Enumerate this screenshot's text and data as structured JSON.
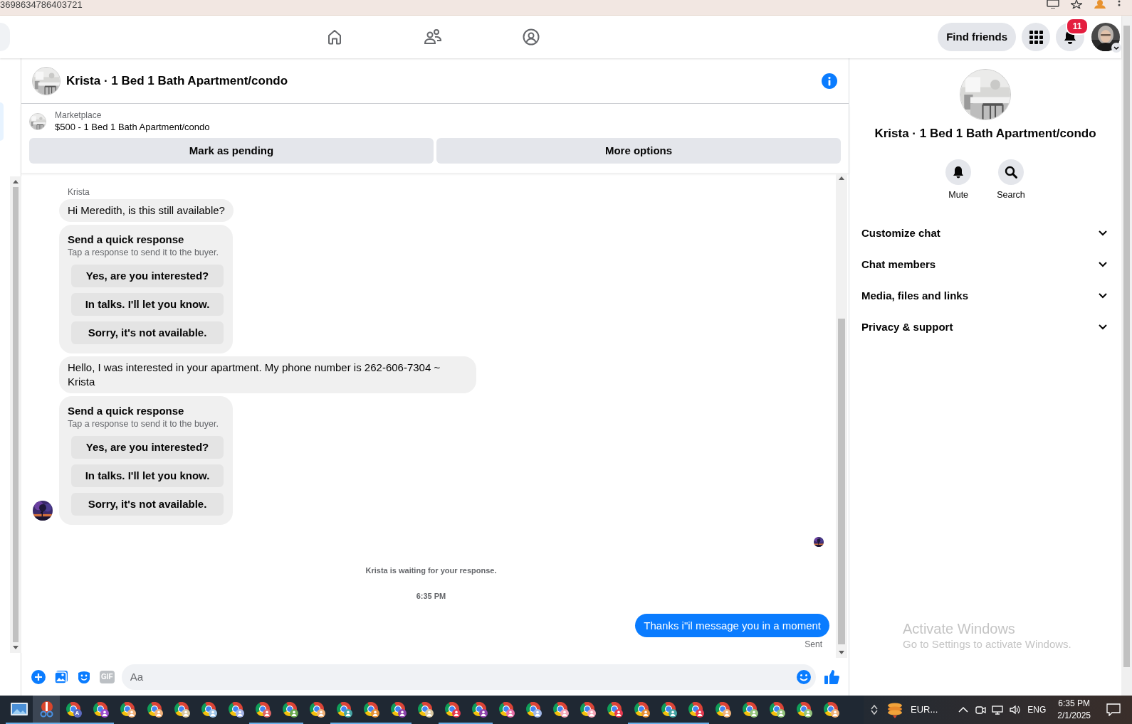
{
  "browser": {
    "address": "3698634786403721"
  },
  "nav": {
    "find_friends": "Find friends",
    "notification_count": "11"
  },
  "chat": {
    "title": "Krista · 1 Bed 1 Bath Apartment/condo",
    "listing": {
      "source": "Marketplace",
      "title": "$500 - 1 Bed 1 Bath Apartment/condo"
    },
    "actions": [
      "Mark as pending",
      "More options"
    ],
    "messages": [
      {
        "kind": "sender",
        "text": "Krista"
      },
      {
        "kind": "incoming",
        "text": "Hi Meredith, is this still available?"
      },
      {
        "kind": "quick_response",
        "title": "Send a quick response",
        "subtitle": "Tap a response to send it to the buyer.",
        "options": [
          "Yes, are you interested?",
          "In talks. I'll let you know.",
          "Sorry, it's not available."
        ],
        "avatar": false
      },
      {
        "kind": "incoming",
        "text": "Hello, I was interested in your apartment. My phone number is 262-606-7304 ~ Krista"
      },
      {
        "kind": "quick_response",
        "title": "Send a quick response",
        "subtitle": "Tap a response to send it to the buyer.",
        "options": [
          "Yes, are you interested?",
          "In talks. I'll let you know.",
          "Sorry, it's not available."
        ],
        "avatar": true
      },
      {
        "kind": "seen"
      },
      {
        "kind": "notice",
        "text": "Krista is waiting for your response."
      },
      {
        "kind": "timestamp",
        "text": "6:35 PM"
      },
      {
        "kind": "outgoing",
        "text": "Thanks i\"il message you in a moment",
        "status": "Sent"
      }
    ],
    "composer": {
      "gif_label": "GIF",
      "placeholder": "Aa"
    }
  },
  "details": {
    "title": "Krista · 1 Bed 1 Bath Apartment/condo",
    "actions": [
      {
        "kind": "mute",
        "label": "Mute"
      },
      {
        "kind": "search",
        "label": "Search"
      }
    ],
    "sections": [
      {
        "label": "Customize chat",
        "expanded": false
      },
      {
        "label": "Chat members",
        "expanded": false
      },
      {
        "label": "Media, files and links",
        "expanded": false
      },
      {
        "label": "Privacy & support",
        "expanded": false
      }
    ]
  },
  "activation_notice": {
    "title": "Activate Windows",
    "subtitle": "Go to Settings to activate Windows."
  },
  "taskbar": {
    "apps": [
      {
        "kind": "photos",
        "open": true,
        "selected": false
      },
      {
        "kind": "snip",
        "open": true,
        "selected": true
      },
      {
        "kind": "chrome",
        "open": true,
        "selected": false,
        "color": "#5c6bc0",
        "badge_text": "A"
      },
      {
        "kind": "chrome",
        "open": true,
        "selected": false,
        "color": "#9c4dcc"
      },
      {
        "kind": "chrome",
        "open": false,
        "selected": false,
        "color": "#f0b27a"
      },
      {
        "kind": "chrome",
        "open": false,
        "selected": false,
        "color": "#f0b27a"
      },
      {
        "kind": "chrome",
        "open": false,
        "selected": false,
        "color": "#d9c9a3"
      },
      {
        "kind": "chrome",
        "open": false,
        "selected": false,
        "color": "#9fc5e8"
      },
      {
        "kind": "chrome",
        "open": false,
        "selected": false,
        "color": "#a4b4e8"
      },
      {
        "kind": "chrome",
        "open": true,
        "selected": false,
        "color": "#e06666"
      },
      {
        "kind": "chrome",
        "open": true,
        "selected": false,
        "color": "#6aa84f"
      },
      {
        "kind": "chrome",
        "open": false,
        "selected": false,
        "color": "#f0b27a"
      },
      {
        "kind": "chrome",
        "open": true,
        "selected": false,
        "color": "#45a5a5"
      },
      {
        "kind": "chrome",
        "open": true,
        "selected": false,
        "color": "#e69138"
      },
      {
        "kind": "chrome",
        "open": true,
        "selected": false,
        "color": "#8e44ad"
      },
      {
        "kind": "chrome",
        "open": false,
        "selected": false,
        "color": "#d9c9a3"
      },
      {
        "kind": "chrome",
        "open": true,
        "selected": false,
        "color": "#e53950"
      },
      {
        "kind": "chrome",
        "open": true,
        "selected": false,
        "color": "#8e44ad"
      },
      {
        "kind": "chrome",
        "open": false,
        "selected": false,
        "color": "#e86fa8"
      },
      {
        "kind": "chrome",
        "open": false,
        "selected": false,
        "color": "#9fb7e8"
      },
      {
        "kind": "chrome",
        "open": false,
        "selected": false,
        "color": "#f4a6b8"
      },
      {
        "kind": "chrome",
        "open": false,
        "selected": false,
        "color": "#f4a6b8"
      },
      {
        "kind": "chrome",
        "open": false,
        "selected": false,
        "color": "#e53950"
      },
      {
        "kind": "chrome",
        "open": true,
        "selected": false,
        "color": "#e69138"
      },
      {
        "kind": "chrome",
        "open": true,
        "selected": false,
        "color": "#45a5a5"
      },
      {
        "kind": "chrome",
        "open": true,
        "selected": false,
        "color": "#e53950"
      },
      {
        "kind": "chrome",
        "open": false,
        "selected": false,
        "color": "#f0b27a"
      },
      {
        "kind": "chrome",
        "open": false,
        "selected": false,
        "color": "#93c47d"
      },
      {
        "kind": "chrome",
        "open": false,
        "selected": false,
        "color": "#93c47d"
      },
      {
        "kind": "chrome",
        "open": false,
        "selected": false,
        "color": "#93c47d"
      },
      {
        "kind": "chrome",
        "open": false,
        "selected": false,
        "color": "#f0b27a"
      }
    ],
    "tray": {
      "widget": "EUR...",
      "language": "ENG",
      "time": "6:35 PM",
      "date": "2/1/2025"
    }
  }
}
